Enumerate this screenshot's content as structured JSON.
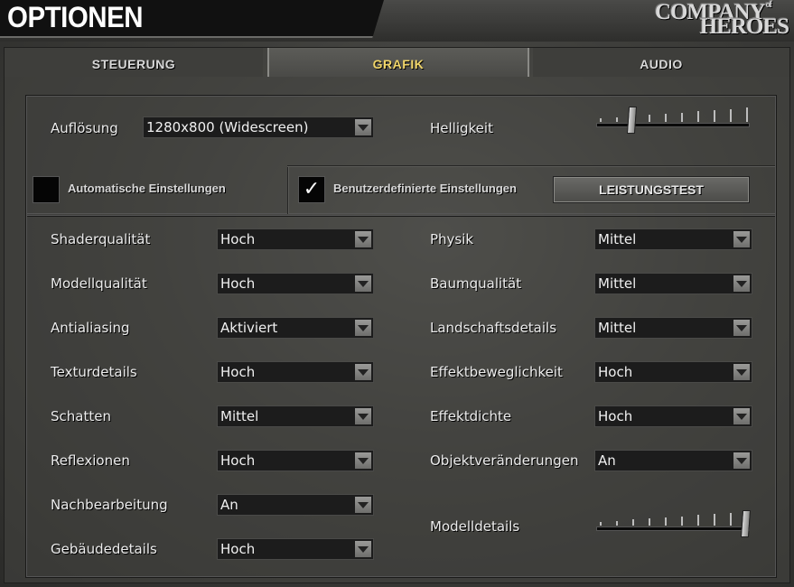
{
  "header": {
    "title": "OPTIONEN",
    "brand_line1": "COMPANY",
    "brand_of": "of",
    "brand_line2": "HEROES"
  },
  "tabs": [
    {
      "label": "STEUERUNG",
      "active": false
    },
    {
      "label": "GRAFIK",
      "active": true
    },
    {
      "label": "AUDIO",
      "active": false
    }
  ],
  "resolution": {
    "label": "Auflösung",
    "value": "1280x800 (Widescreen)"
  },
  "brightness": {
    "label": "Helligkeit",
    "level": 0.22
  },
  "auto_settings": {
    "label": "Automatische Einstellungen",
    "checked": false
  },
  "custom_settings": {
    "label": "Benutzerdefinierte Einstellungen",
    "checked": true,
    "mark": "✓"
  },
  "performance_test": {
    "label": "LEISTUNGSTEST"
  },
  "left_settings": [
    {
      "label": "Shaderqualität",
      "value": "Hoch"
    },
    {
      "label": "Modellqualität",
      "value": "Hoch"
    },
    {
      "label": "Antialiasing",
      "value": "Aktiviert"
    },
    {
      "label": "Texturdetails",
      "value": "Hoch"
    },
    {
      "label": "Schatten",
      "value": "Mittel"
    },
    {
      "label": "Reflexionen",
      "value": "Hoch"
    },
    {
      "label": "Nachbearbeitung",
      "value": "An"
    },
    {
      "label": "Gebäudedetails",
      "value": "Hoch"
    }
  ],
  "right_settings": [
    {
      "label": "Physik",
      "value": "Mittel"
    },
    {
      "label": "Baumqualität",
      "value": "Mittel"
    },
    {
      "label": "Landschaftsdetails",
      "value": "Mittel"
    },
    {
      "label": "Effektbeweglichkeit",
      "value": "Hoch"
    },
    {
      "label": "Effektdichte",
      "value": "Hoch"
    },
    {
      "label": "Objektveränderungen",
      "value": "An"
    }
  ],
  "model_details": {
    "label": "Modelldetails",
    "level": 1.0
  },
  "colors": {
    "active_tab": "#f1d66a",
    "text": "#ececec",
    "select_bg": "#1c1c1c"
  }
}
